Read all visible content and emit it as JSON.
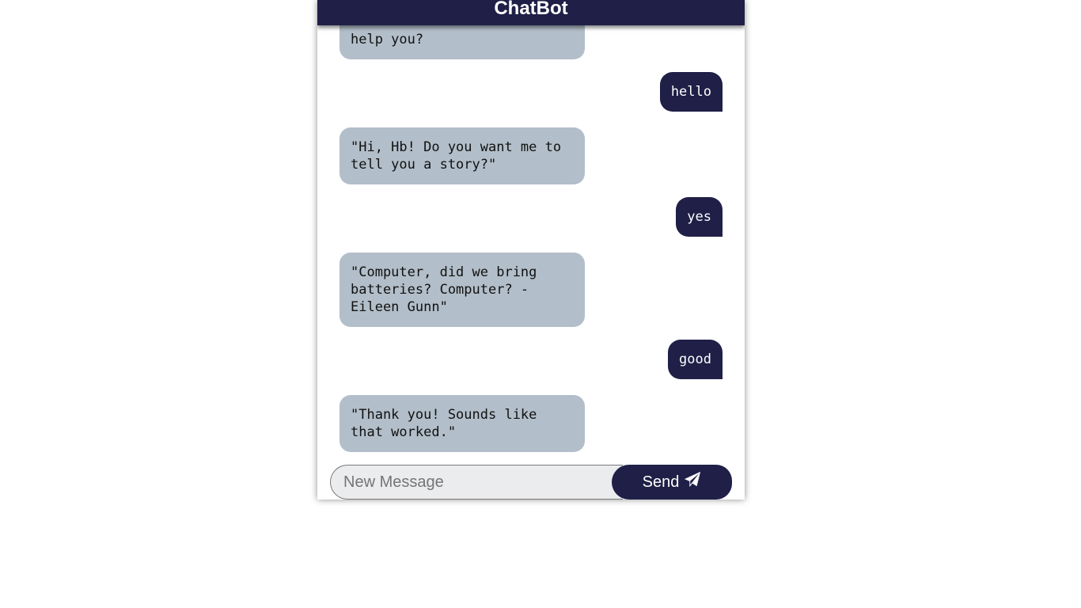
{
  "header": {
    "title": "ChatBot"
  },
  "messages": [
    {
      "role": "bot",
      "text": "help you?"
    },
    {
      "role": "user",
      "text": "hello"
    },
    {
      "role": "bot",
      "text": "\"Hi, Hb! Do you want me to tell you a story?\""
    },
    {
      "role": "user",
      "text": "yes"
    },
    {
      "role": "bot",
      "text": "\"Computer, did we bring batteries? Computer? - Eileen Gunn\""
    },
    {
      "role": "user",
      "text": "good"
    },
    {
      "role": "bot",
      "text": "\"Thank you! Sounds like that worked.\""
    }
  ],
  "composer": {
    "placeholder": "New Message",
    "value": "",
    "send_label": "Send",
    "send_icon": "paper-plane-icon"
  },
  "colors": {
    "header_bg": "#1f1f47",
    "user_bubble": "#1f1f47",
    "bot_bubble": "#b2bec9",
    "input_bg": "#ebecee"
  }
}
